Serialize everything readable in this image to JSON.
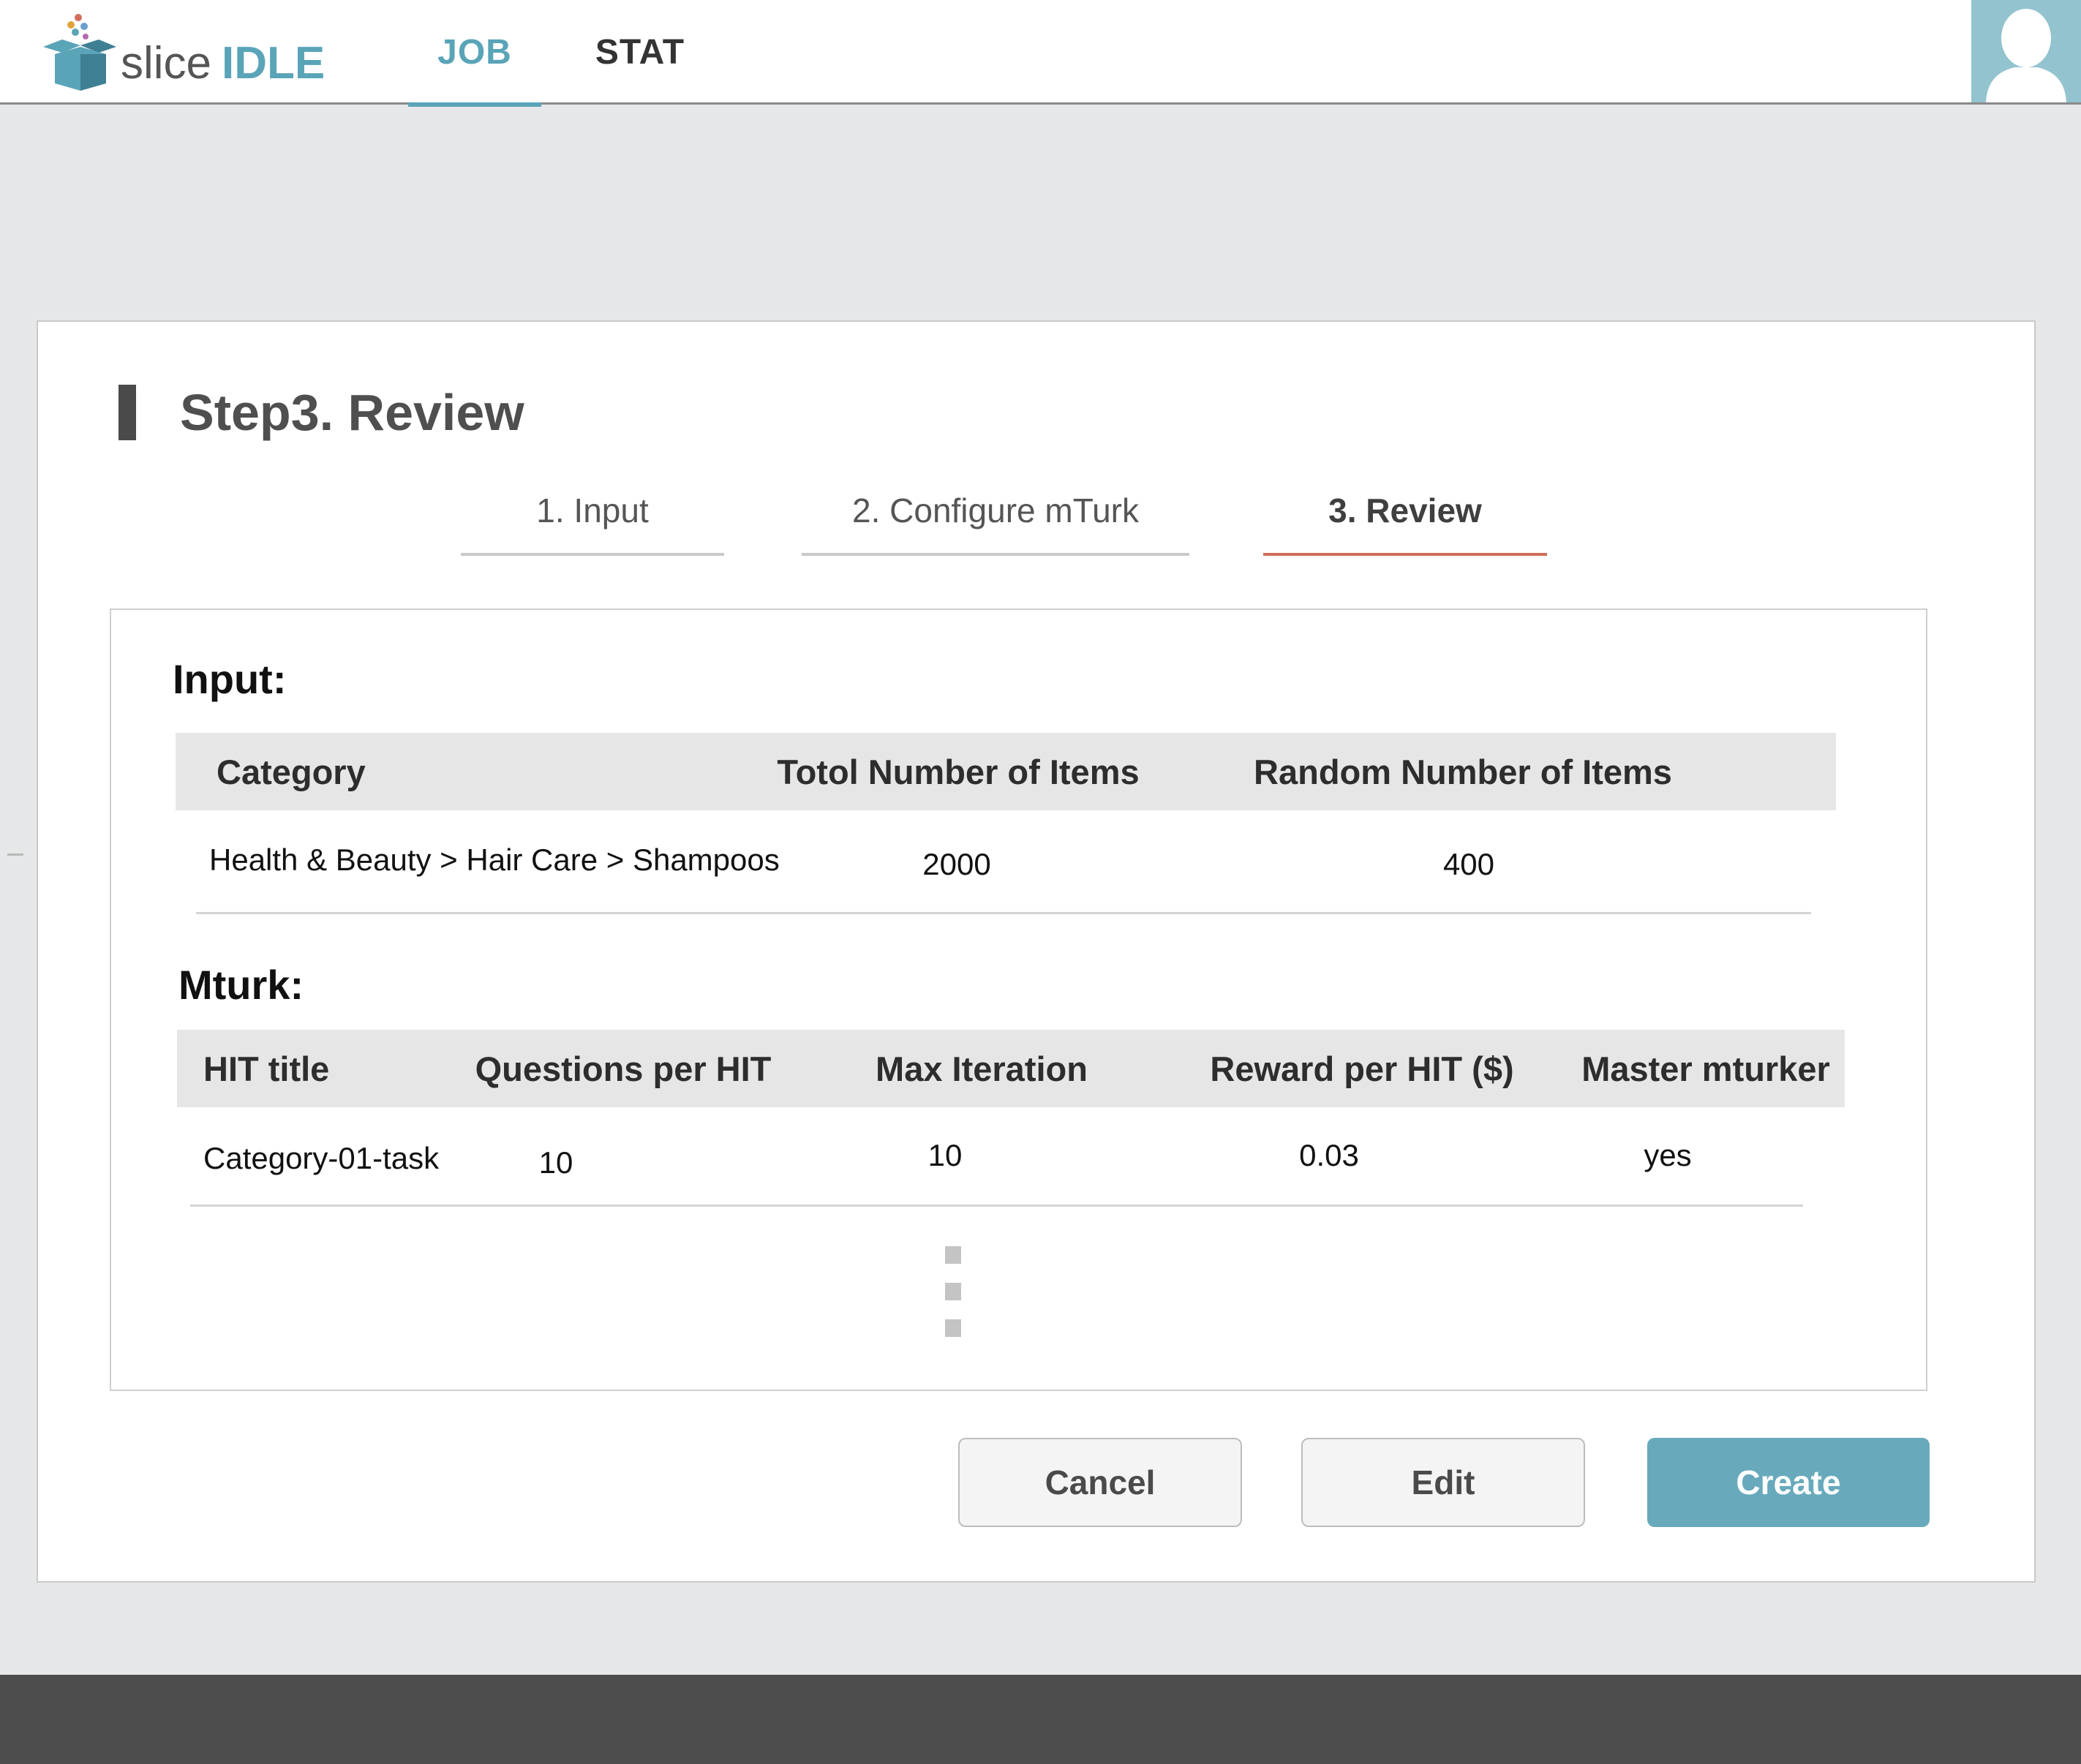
{
  "app": {
    "logo_word1": "slice",
    "logo_word2": "IDLE",
    "brand_color": "#5aa4b8"
  },
  "nav": {
    "tabs": [
      {
        "label": "JOB",
        "active": true
      },
      {
        "label": "STAT",
        "active": false
      }
    ],
    "avatar_icon": "user-avatar-icon"
  },
  "page": {
    "title": "Step3. Review"
  },
  "wizard": {
    "steps": [
      {
        "label": "1. Input",
        "active": false
      },
      {
        "label": "2.  Configure mTurk",
        "active": false
      },
      {
        "label": "3. Review",
        "active": true
      }
    ],
    "active_color": "#d06d5a"
  },
  "input_section": {
    "heading": "Input:",
    "columns": [
      "Category",
      "Totol Number of Items",
      "Random Number of Items"
    ],
    "rows": [
      [
        "Health & Beauty > Hair Care > Shampoos",
        "2000",
        "400"
      ]
    ]
  },
  "mturk_section": {
    "heading": "Mturk:",
    "columns": [
      "HIT title",
      "Questions per HIT",
      "Max Iteration",
      "Reward per HIT ($)",
      "Master mturker"
    ],
    "rows": [
      [
        "Category-01-task",
        "10",
        "10",
        "0.03",
        "yes"
      ]
    ]
  },
  "actions": {
    "cancel_label": "Cancel",
    "edit_label": "Edit",
    "create_label": "Create",
    "create_color": "#68aabc"
  }
}
